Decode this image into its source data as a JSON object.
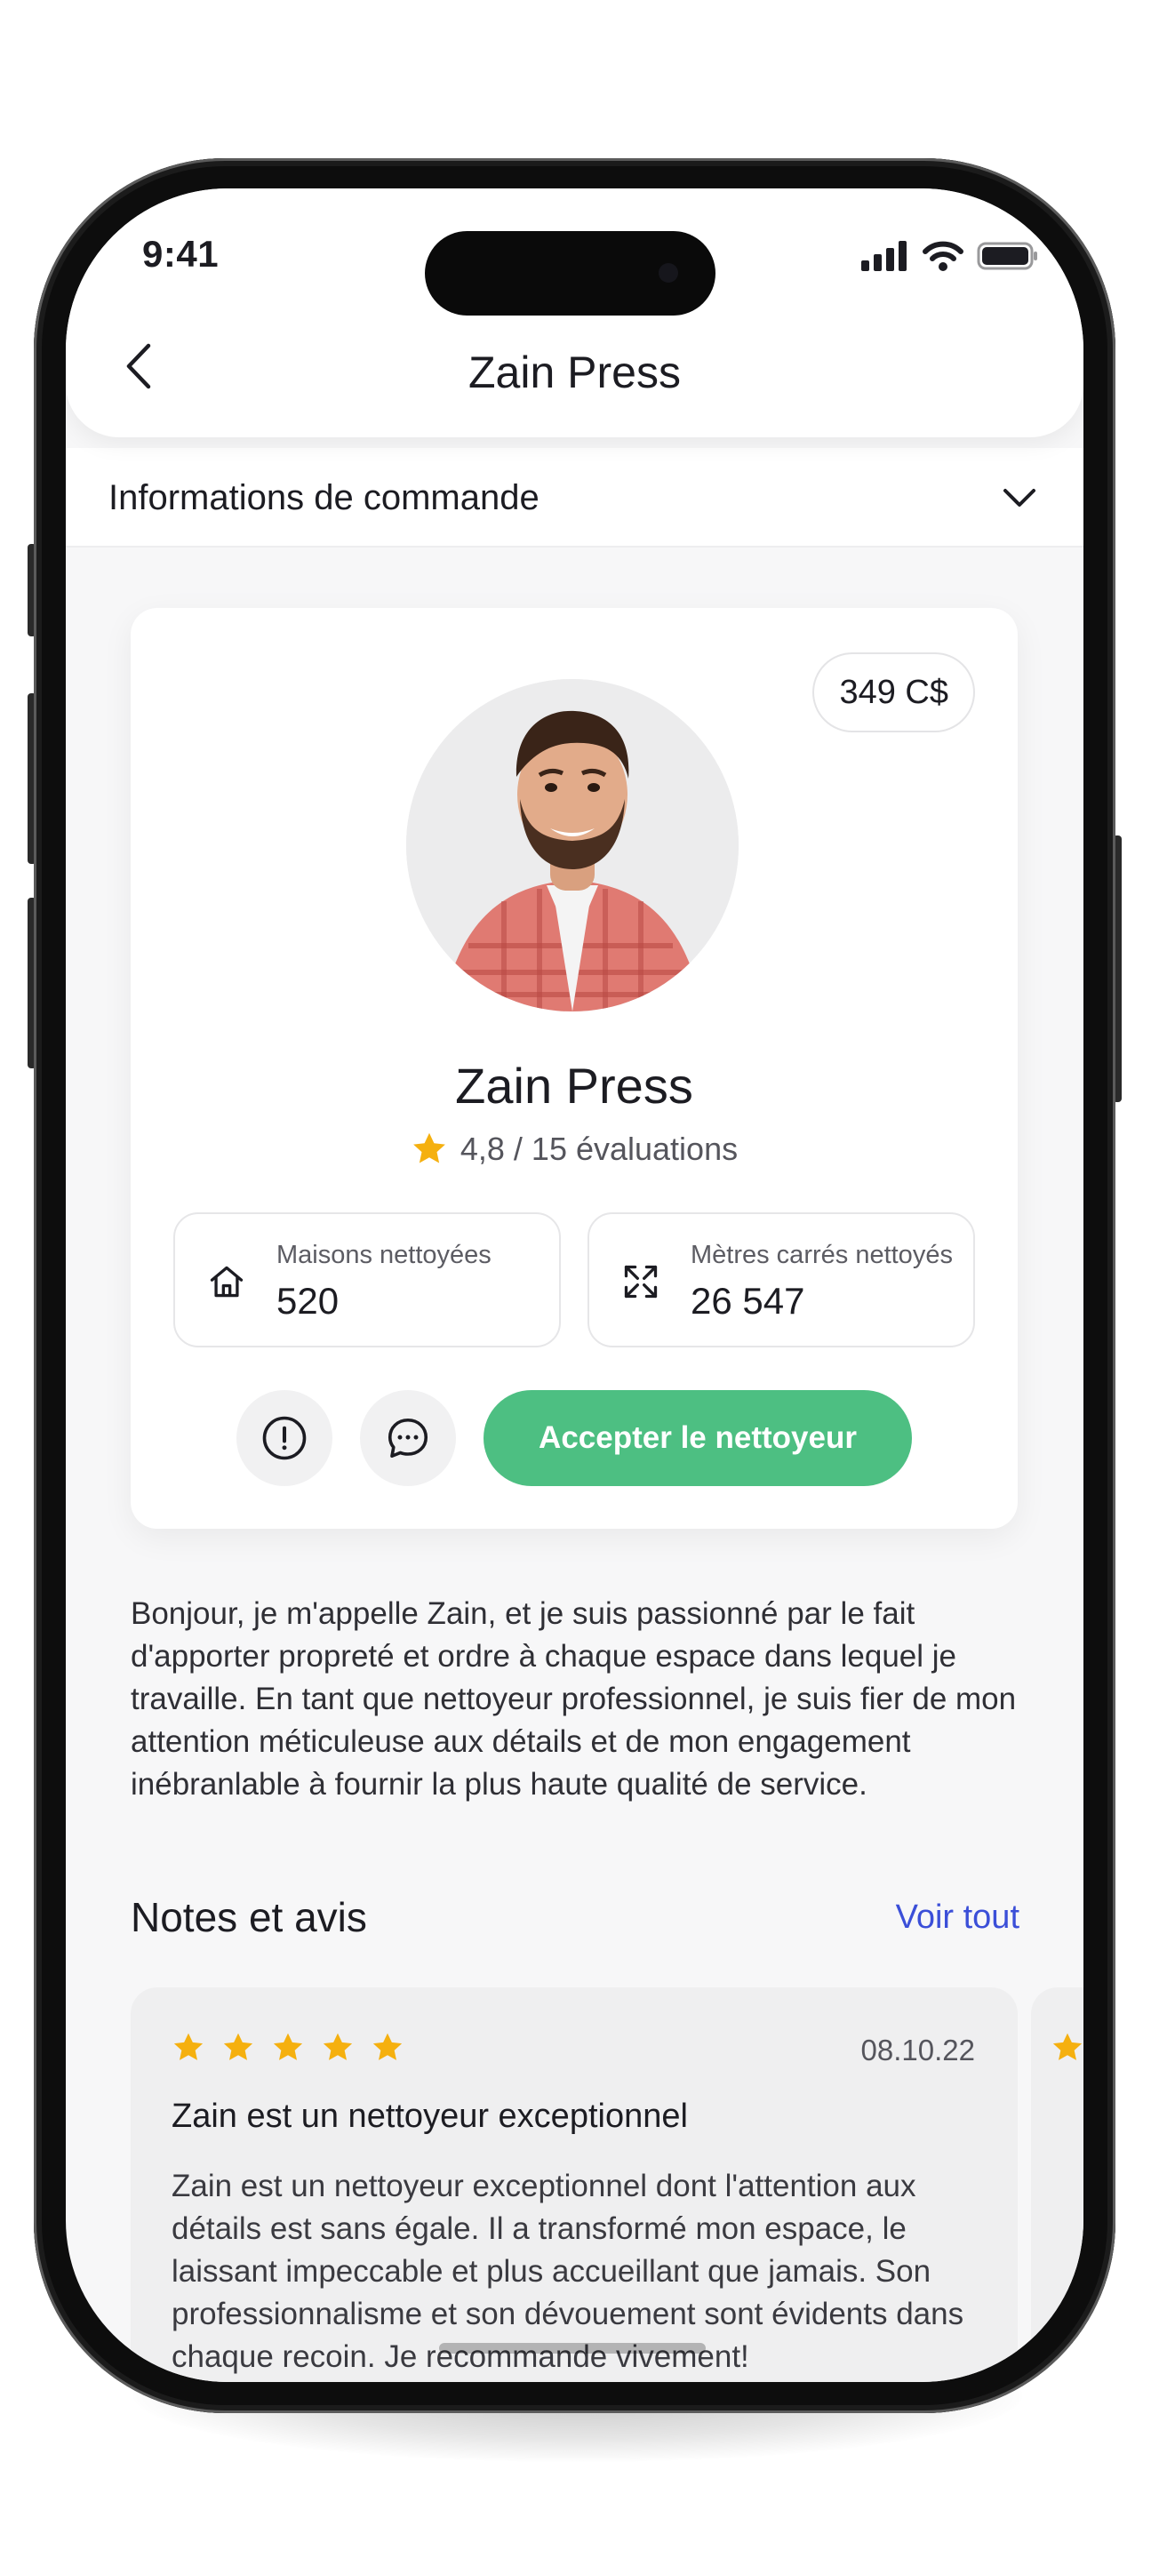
{
  "status_bar": {
    "time": "9:41"
  },
  "header": {
    "title": "Zain Press",
    "back_icon": "chevron-left-icon"
  },
  "order_info": {
    "label": "Informations de commande",
    "chevron_icon": "chevron-down-icon"
  },
  "profile": {
    "price": "349 C$",
    "name": "Zain Press",
    "rating_text": "4,8 / 15 évaluations",
    "rating_value": 4.8,
    "rating_count": 15,
    "star_color": "#F5B00F",
    "stats": [
      {
        "icon": "house-icon",
        "label": "Maisons nettoyées",
        "value": "520"
      },
      {
        "icon": "expand-icon",
        "label": "Mètres carrés nettoyés",
        "value": "26 547"
      }
    ],
    "actions": {
      "report_icon": "alert-circle-icon",
      "chat_icon": "chat-bubble-icon",
      "accept_label": "Accepter le nettoyeur",
      "accept_color": "#4DBF82"
    }
  },
  "bio": "Bonjour, je m'appelle Zain, et je suis passionné par le fait d'apporter propreté et ordre à chaque espace dans lequel je travaille. En tant que nettoyeur professionnel, je suis fier de mon attention méticuleuse aux détails et de mon engagement inébranlable à fournir la plus haute qualité de service.",
  "reviews_section": {
    "title": "Notes et avis",
    "see_all": "Voir tout",
    "link_color": "#3B4FD8",
    "reviews": [
      {
        "stars": 5,
        "date": "08.10.22",
        "title": "Zain est un nettoyeur exceptionnel",
        "body": "Zain est un nettoyeur exceptionnel dont l'attention aux détails est sans égale. Il a transformé mon espace, le laissant impeccable et plus accueillant que jamais. Son professionnalisme et son dévouement sont évidents dans chaque recoin. Je recommande vivement!"
      }
    ]
  }
}
